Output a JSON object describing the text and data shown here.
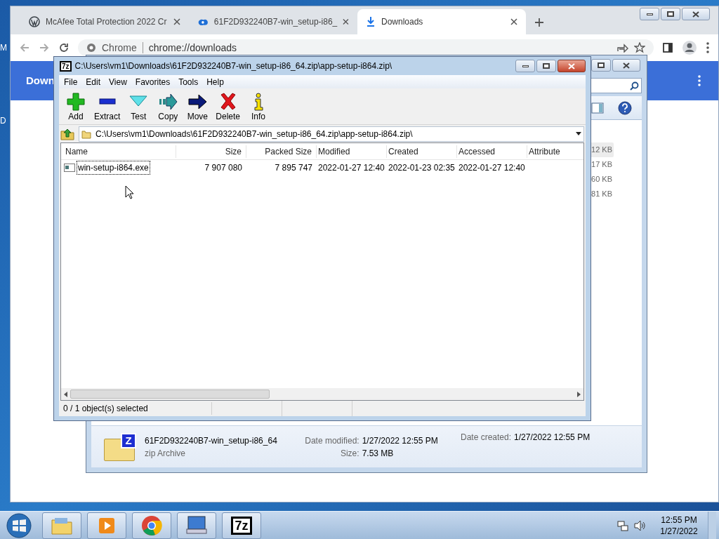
{
  "desktop": {
    "icon_labels": [
      "M",
      "D"
    ]
  },
  "browser": {
    "tabs": [
      {
        "title": "McAfee Total Protection 2022 Cr",
        "kind": "wordpress",
        "selected": false
      },
      {
        "title": "61F2D932240B7-win_setup-i86_",
        "kind": "cloud",
        "selected": false
      },
      {
        "title": "Downloads",
        "kind": "download",
        "selected": true
      }
    ],
    "site_label": "Chrome",
    "url": "chrome://downloads",
    "page_title": "Down"
  },
  "explorer": {
    "sizes": [
      {
        "text": "12 KB",
        "selected": true
      },
      {
        "text": "17 KB",
        "selected": false
      },
      {
        "text": "60 KB",
        "selected": false
      },
      {
        "text": "81 KB",
        "selected": false
      }
    ],
    "details": {
      "icon_letter": "Z",
      "name": "61F2D932240B7-win_setup-i86_64",
      "type": "zip Archive",
      "modified_label": "Date modified:",
      "modified": "1/27/2022 12:55 PM",
      "size_label": "Size:",
      "size": "7.53 MB",
      "created_label": "Date created:",
      "created": "1/27/2022 12:55 PM"
    }
  },
  "sevenzip": {
    "icon_label": "7z",
    "title": "C:\\Users\\vm1\\Downloads\\61F2D932240B7-win_setup-i86_64.zip\\app-setup-i864.zip\\",
    "menu": [
      "File",
      "Edit",
      "View",
      "Favorites",
      "Tools",
      "Help"
    ],
    "toolbar": [
      {
        "label": "Add",
        "kind": "add"
      },
      {
        "label": "Extract",
        "kind": "extract"
      },
      {
        "label": "Test",
        "kind": "test"
      },
      {
        "label": "Copy",
        "kind": "copy"
      },
      {
        "label": "Move",
        "kind": "move"
      },
      {
        "label": "Delete",
        "kind": "delete"
      },
      {
        "label": "Info",
        "kind": "info"
      }
    ],
    "path": "C:\\Users\\vm1\\Downloads\\61F2D932240B7-win_setup-i86_64.zip\\app-setup-i864.zip\\",
    "columns": [
      "Name",
      "Size",
      "Packed Size",
      "Modified",
      "Created",
      "Accessed",
      "Attribute"
    ],
    "rows": [
      {
        "cells": [
          "win-setup-i864.exe",
          "7 907 080",
          "7 895 747",
          "2022-01-27 12:40",
          "2022-01-23 02:35",
          "2022-01-27 12:40"
        ],
        "focused": true
      }
    ],
    "status": "0 / 1 object(s) selected"
  },
  "taskbar": {
    "apps": [
      {
        "kind": "explorer"
      },
      {
        "kind": "media"
      },
      {
        "kind": "chrome"
      },
      {
        "kind": "remote"
      },
      {
        "kind": "sevenzip",
        "label": "7z"
      }
    ],
    "time": "12:55 PM",
    "date": "1/27/2022"
  }
}
